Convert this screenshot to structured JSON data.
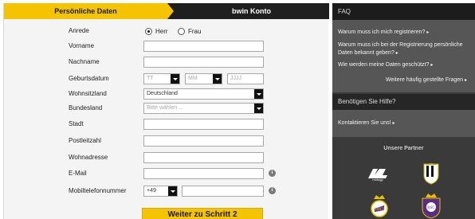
{
  "steps": {
    "active": "Persönliche Daten",
    "next": "bwin Konto"
  },
  "form": {
    "anrede": {
      "label": "Anrede",
      "options": [
        "Herr",
        "Frau"
      ],
      "selected": "Herr"
    },
    "vorname": {
      "label": "Vorname",
      "value": ""
    },
    "nachname": {
      "label": "Nachname",
      "value": ""
    },
    "geburtsdatum": {
      "label": "Geburtsdatum",
      "day_placeholder": "TT",
      "month_placeholder": "MM",
      "year_placeholder": "JJJJ"
    },
    "wohnsitzland": {
      "label": "Wohnsitzland",
      "value": "Deutschland"
    },
    "bundesland": {
      "label": "Bundesland",
      "placeholder": "Bitte wählen ..."
    },
    "stadt": {
      "label": "Stadt",
      "value": ""
    },
    "postleitzahl": {
      "label": "Postleitzahl",
      "value": ""
    },
    "wohnadresse": {
      "label": "Wohnadresse",
      "value": ""
    },
    "email": {
      "label": "E-Mail",
      "value": ""
    },
    "mobil": {
      "label": "Mobiltelefonnummer",
      "prefix": "+49",
      "value": ""
    },
    "info_icon": "i",
    "submit_label": "Weiter zu Schritt 2"
  },
  "sidebar": {
    "faq_title": "FAQ",
    "faq_links": [
      "Warum muss ich mich registrieren?",
      "Warum muss ich bei der Registrierung persönliche Daten bekannt geben?",
      "Wie werden meine Daten geschützt?"
    ],
    "faq_more": "Weitere häufig gestellte Fragen",
    "help_title": "Benötigen Sie Hilfe?",
    "help_link": "Kontaktieren Sie uns!",
    "partners_title": "Unsere Partner",
    "partners": [
      "motogp-logo",
      "juventus-logo",
      "real-madrid-logo",
      "anderlecht-logo"
    ],
    "arrow": "▸"
  },
  "colors": {
    "accent": "#f5c400",
    "dark": "#1f1f1f",
    "sidebar_bg": "#3a3a3a"
  }
}
